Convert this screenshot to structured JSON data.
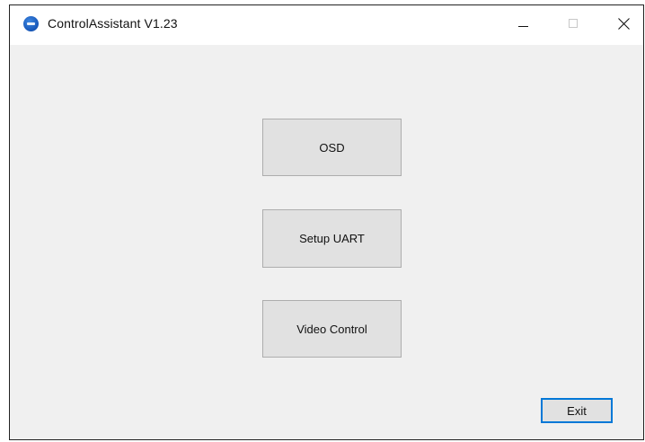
{
  "window": {
    "title": "ControlAssistant V1.23",
    "app_icon": "app-logo-icon",
    "caption_buttons": {
      "minimize_icon": "minimize-icon",
      "maximize_icon": "maximize-icon",
      "close_icon": "close-icon"
    }
  },
  "main": {
    "buttons": [
      {
        "label": "OSD"
      },
      {
        "label": "Setup UART"
      },
      {
        "label": "Video Control"
      }
    ],
    "exit_label": "Exit"
  },
  "colors": {
    "client_background": "#f0f0f0",
    "titlebar_background": "#ffffff",
    "button_face": "#e1e1e1",
    "button_border": "#adadad",
    "focus_border": "#0078d7",
    "app_icon": "#1656b8"
  }
}
